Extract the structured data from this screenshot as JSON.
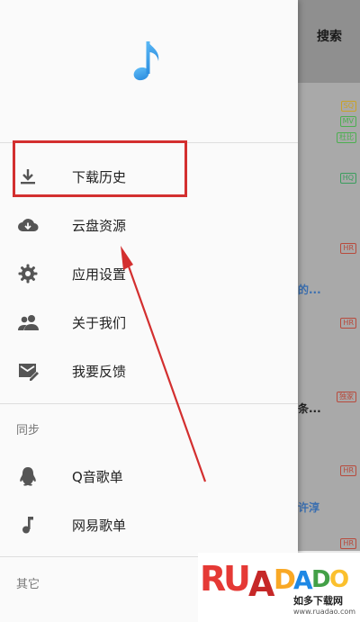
{
  "background": {
    "search_label": "搜索",
    "tags": [
      "SQ",
      "MV",
      "杜比",
      "HQ",
      "HR",
      "HR",
      "独家",
      "HR",
      "HR"
    ],
    "fragments": [
      "的...",
      "条...",
      "许淳"
    ]
  },
  "drawer": {
    "menu": [
      {
        "label": "下载历史",
        "icon": "download-icon"
      },
      {
        "label": "云盘资源",
        "icon": "cloud-download-icon"
      },
      {
        "label": "应用设置",
        "icon": "gear-icon"
      },
      {
        "label": "关于我们",
        "icon": "people-icon"
      },
      {
        "label": "我要反馈",
        "icon": "feedback-icon"
      }
    ],
    "sync_title": "同步",
    "sync_items": [
      {
        "label": "Q音歌单",
        "icon": "qq-penguin-icon"
      },
      {
        "label": "网易歌单",
        "icon": "music-note-icon"
      }
    ],
    "other_title": "其它"
  },
  "annotation": {
    "color": "#d32f2f"
  },
  "watermark": {
    "logo": "RUADADO",
    "subtitle": "如多下载网",
    "url": "www.ruadao.com"
  }
}
